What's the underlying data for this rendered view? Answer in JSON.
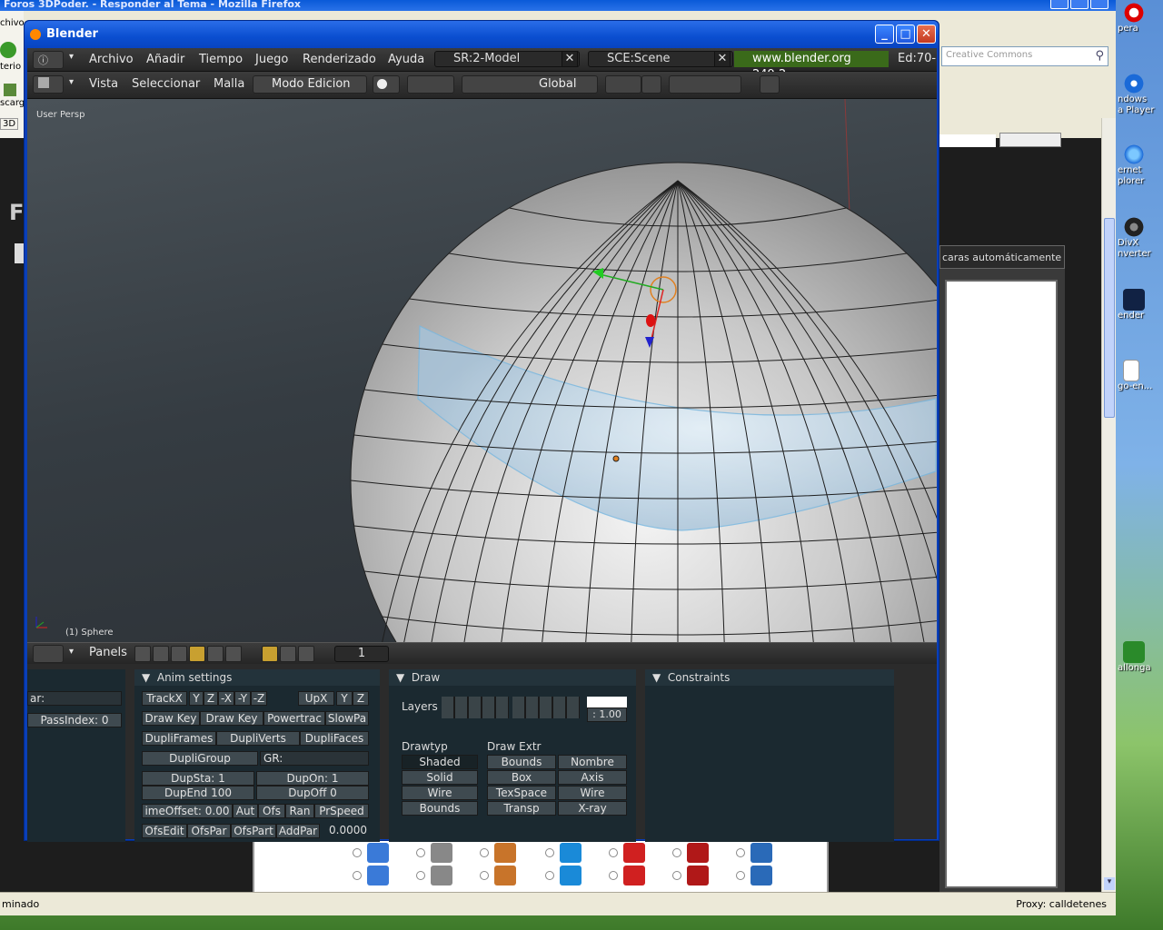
{
  "firefox": {
    "title": "Foros 3DPoder. - Responder al Tema - Mozilla Firefox",
    "side_texts": [
      "chivo",
      "terio",
      "scarg",
      "3D"
    ],
    "search_placeholder": "Creative Commons",
    "status_left": "minado",
    "status_proxy": "Proxy: calldetenes",
    "auto_caras": "caras automáticamente"
  },
  "desktop_icons": [
    {
      "label": "pera"
    },
    {
      "label": "ndows\na Player"
    },
    {
      "label": "ernet\nplorer"
    },
    {
      "label": "DivX\nnverter"
    },
    {
      "label": "ender"
    },
    {
      "label": "go-en..."
    },
    {
      "label": "allonga"
    }
  ],
  "blender": {
    "window_title": "Blender",
    "top_menu": [
      "Archivo",
      "Añadir",
      "Tiempo",
      "Juego",
      "Renderizado",
      "Ayuda"
    ],
    "screen": "SR:2-Model",
    "scene": "SCE:Scene",
    "version": "www.blender.org 249.2",
    "edit_info": "Ed:70-",
    "view_menu": [
      "Vista",
      "Seleccionar",
      "Malla"
    ],
    "mode": "Modo Edicion",
    "orientation": "Global",
    "viewport_label": "User Persp",
    "object_label": "(1) Sphere",
    "buttons_header": {
      "panels": "Panels",
      "frame": "1"
    },
    "left_panel": {
      "field1": "ar:",
      "pass_index": "PassIndex: 0"
    },
    "anim": {
      "title": "Anim settings",
      "row1": [
        "TrackX",
        "Y",
        "Z",
        "-X",
        "-Y",
        "-Z",
        "UpX",
        "Y",
        "Z"
      ],
      "row2": [
        "Draw Key",
        "Draw Key",
        "Powertrac",
        "SlowPa"
      ],
      "row3": [
        "DupliFrames",
        "DupliVerts",
        "DupliFaces"
      ],
      "dupligroup": "DupliGroup",
      "gr": "GR:",
      "dupsta": "DupSta: 1",
      "dupon": "DupOn: 1",
      "dupend": "DupEnd 100",
      "dupoff": "DupOff 0",
      "row6": [
        "imeOffset: 0.00",
        "Aut",
        "Ofs",
        "Ran",
        "PrSpeed"
      ],
      "row7": [
        "OfsEdit",
        "OfsPar",
        "OfsPart",
        "AddPar"
      ],
      "speed_val": "0.0000"
    },
    "draw": {
      "title": "Draw",
      "layers": "Layers",
      "alpha": ": 1.00",
      "drawtype_label": "Drawtyp",
      "drawextr_label": "Draw Extr",
      "drawtype": [
        "Shaded",
        "Solid",
        "Wire",
        "Bounds"
      ],
      "extr_left": [
        "Bounds",
        "Box",
        "TexSpace",
        "Transp"
      ],
      "extr_right": [
        "Nombre",
        "Axis",
        "Wire",
        "X-ray"
      ]
    },
    "constraints": {
      "title": "Constraints"
    }
  }
}
